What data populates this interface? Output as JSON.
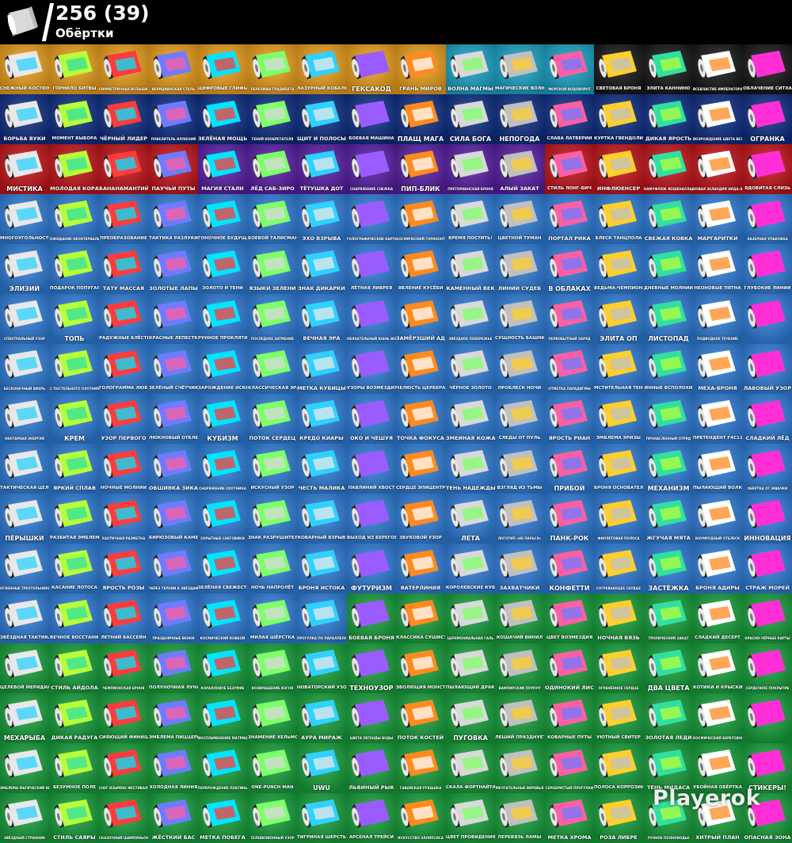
{
  "header": {
    "count": "256 (39)",
    "subtitle": "Обёртки",
    "icon": "wrap-roll-icon"
  },
  "watermark": "Playerok",
  "rarity_colors": {
    "O": "#f0a21c",
    "T": "#1aa6c9",
    "K": "#171717",
    "R": "#0e2f87",
    "E": "#c8141a",
    "P": "#5a1fa8",
    "B": "#2f7fdc",
    "G": "#17a23c"
  },
  "rows": [
    "OOOOOOOOOTTTKKKK",
    "RRRRRRRRRRRRRRRR",
    "EEEEPPPPPPPEEEEE",
    "BBBBBBBBBBBBBBBB",
    "BBBBBBBBBBBBBBBB",
    "BBBBBBBBBBBBBBBB",
    "BBBBBBBBBBBBBBBB",
    "BBBBBBBBBBBBBBBB",
    "BBBBBBBBBBBBBBBB",
    "BBBBBBBBBBBBBBBB",
    "BBBBBBBBBBBBBBBB",
    "BBBBBBBGGGGGGGGG",
    "GGGGGGGGGGGGGGGG",
    "GGGGGGGGGGGGGGGG",
    "GGGGGGGGGGGGGGGG",
    "GGGGGGGGGGGGGGGG"
  ],
  "row_classes": [
    "",
    "E",
    "",
    "",
    "",
    "",
    "",
    "",
    "",
    "",
    "",
    "",
    "",
    "",
    "",
    ""
  ],
  "palette": [
    "#e8e8e8",
    "#ff5fa2",
    "#2ed1ff",
    "#b6ff3a",
    "#ffcf2e",
    "#9b5cff",
    "#ff3b3b",
    "#31e0a0",
    "#ff8a1f",
    "#6f7bff",
    "#ffffff",
    "#d9d9d9",
    "#00e5ff",
    "#ff2fd6",
    "#c0c0c0",
    "#7dff6a"
  ],
  "items": [
    "СНЕЖНЫЙ КОСТЮМ",
    "ГОРНИЛО БИТВЫ",
    "СИММЕТРИЧНАЯ ВСПЫШКА",
    "ВЕРИДИАНСКАЯ СТАЛЬ",
    "ЦИФРОВЫЕ ГЛИФЫ",
    "ПЕРЕЛИВЫ ГРАДИЕНТА",
    "ЛАЗУРНЫЙ КОБАЛЬТ",
    "ГЕКСАКОД",
    "ГРАНЬ МИРОВ",
    "ВОЛНА МАГМЫ",
    "МАГИЧЕСКИЕ ВОЛНЫ",
    "МОРСКОЙ ВОДОВОРОТ",
    "СВЕТОВАЯ БРОНЯ",
    "ЭЛИТА КАННИНО",
    "ВСЕВЛАСТИЕ ИМПЕРАТОРА",
    "ОБЛАЧЕНИЕ СИТХА",
    "БОРЬБА ВУКИ",
    "МОМЕНТ ВЫБОРА",
    "ЧЁРНЫЙ ЛИДЕР",
    "ПОВЕЛИТЕЛЬ ИЛЛЮЗИЙ",
    "ЗЕЛЁНАЯ МОЩЬ",
    "ГЕНИЙ ИЗОБРЕТАТЕЛЯ",
    "ЩИТ И ПОЛОСЫ",
    "БОЕВАЯ МАШИНА",
    "ПЛАЩ МАГА",
    "СИЛА БОГА",
    "НЕПОГОДА",
    "СЛАВА ЛАТВЕРИИ",
    "КУРТКА ГВЕНДОЛИН",
    "ДИКАЯ ЯРОСТЬ",
    "ВОЗРОЖДЕНИЕ ЦВЕТА ВЕЗДЕ",
    "ОГРАНКА",
    "МИСТИКА",
    "МОЛОДАЯ КОРА",
    "БАНАНАМАНТИЙ",
    "ПАУЧЬИ ПУТЫ",
    "МАГИЯ СТАЛИ",
    "ЛЁД САБ-ЗИРО",
    "ТЁТУШКА ДОТ",
    "СНАРЯЖЕНИЕ СНЕЖКА",
    "ПИП-БЛИК",
    "ПРЕТОРИАНСКАЯ БРОНЯ",
    "АЛЫЙ ЗАКАТ",
    "СТИЛЬ ЛОНГ-БИЧ",
    "ИНФЛЮЕНСЕР",
    "КАМУФЛЯЖ ЯОШЕНАЛЛАДИ",
    "НОВАЯ ЗЕЛАНДИЯ НИДА-ЖАЛЬФИН",
    "ЯДОВИТАЯ СЛИЗЬ",
    "МНОГОУГОЛЬНОСТЬ",
    "ОЖИДАНИЕ НЕОНТЕРВАЛЬНИЯ",
    "ПРЕОБРАЗОВАНИЕ",
    "ТАКТИКА РАЗЛУКИ",
    "ГОНОЧНОЕ БУДУЩЕЕ",
    "БОЕВОЙ ТАЛИСМАН",
    "ЭХО ВЗРЫВА",
    "ГОЛОГРАФИЧЕСКИЕ КАРТИНКИ",
    "КОСМИЧЕСКИЙ ГОРИЗОНТ",
    "ВРЕМЯ ПОСТИТЬ!",
    "ЦВЕТНОЙ ТУМАН",
    "ПОРТАЛ РИКА",
    "БЛЕСК ТАНЦПОЛА",
    "СВЕЖАЯ КОВКА",
    "МАРГАРИТКИ",
    "ЛАЗЕРНАЯ УПАКОВКА",
    "ЭЛИЗИЙ",
    "ПОДАРОК ПОПУГАЯ",
    "ТАТУ МАССАЯ",
    "ЗОЛОТЫЕ ЛАПЫ",
    "ЗОЛОТО И ТЕНИ",
    "ЯЗЫКИ ЗЕЛЕНИ",
    "ЗНАК ДИКАРКИ",
    "ЛЁТНАЯ ЛИВРЕЯ",
    "ЯВЛЕНИЕ КУСЁБИ",
    "КАМЕННЫЙ ВЕК",
    "ЛИНИИ СУДЕБ",
    "В ОБЛАКАХ",
    "ВЕДЬМА-ЧЕМПИОНКА",
    "ДНЕВНЫЕ МОЛНИИ",
    "НЕОНОВЫЕ ПЯТНА",
    "ГЛУБОКИЕ ЛИНИИ",
    "СПЕКТРАЛЬНЫЙ УЗОР",
    "ТОПЬ",
    "РАДУЖНЫЕ БЛЁСТКИ",
    "КРАСНЫЕ ЛЕПЕСТКИ",
    "РУННОЕ ПРОКЛЯТИЕ",
    "ПОСЛЕДНЕЕ ЗАТМЕНИЕ",
    "ВЕЧНАЯ ЭРА",
    "ОБЯЗАТЕЛЬНЫЙ ЮАНЬ ВЕСТРА",
    "ЗАМЁРЗШИЙ АД",
    "ЗВЁЗДНОЕ ПОБЕРЕЖЬЕ",
    "СУЩНОСТЬ БАШНИ",
    "ПЕРВОБЫТНЫЙ ЗАРЯД",
    "ЭЛИТА ОП",
    "ЛИСТОПАД",
    "ПОДВОДНОЕ ТЕЧЕНИЕ",
    "",
    "БЕСКОНЕЧНЫЙ ВИХРЬ",
    "С ПОСТЕЛЬНОГО ОХОТНИК",
    "ГОЛОГРАММА ЛЮБВИ",
    "ЗЕЛЁНЫЙ СЧЁТЧИК",
    "ЗАРОЖДЕНИЕ ИСКРЫ",
    "КЛАССИЧЕСКАЯ ЭРА",
    "МЕТКА КУБИЦЫ",
    "УЗОРЫ ВОЗМЕЗДИЯ",
    "ЧЕЛЮСТЬ ЦЕРБЕРА",
    "ЧЁРНОЕ ЗОЛОТО",
    "ПРОБЛЕСК НОЧИ",
    "ОТМЕТКА ПАРАДИГМЫ",
    "МСТИТЕЛЬНАЯ ТЕНЬ",
    "ИННЫЕ ВСПОЛОХИ",
    "МЕХА-БРОНЯ",
    "ЛАВОВЫЙ УЗОР",
    "НЕКТАРНАЯ ЭНЕРГИЯ",
    "КРЕМ",
    "УЗОР ПЕРВОГО",
    "ЛЮКНОВЫЙ ОТБЛЕСК",
    "КУБИЗМ",
    "ПОТОК СЕРДЕЦ",
    "КРЕДО КИАРЫ",
    "ОКО И ЧЕШУЯ",
    "ТОЧКА ФОКУСА",
    "ЗМЕИНАЯ КОЖА",
    "СЛЕДЫ ОТ ПУЛЬ",
    "ЯРОСТЬ РИАН",
    "ЭМБЛЕМА ЭРИЗЫ",
    "ПРОНАСЛЕННЫЙ ОТРЯД",
    "ПРЕТЕНДЕНТ F4C11",
    "СЛАДКИЙ ЛЁД",
    "ТАКТИЧЕСКАЯ ЦЕЛЬ",
    "ЯРКИЙ СПЛАВ",
    "НОЧНЫЕ МОЛНИИ",
    "ОБШИВКА ЗИКА",
    "СНАРЯЖЕНИЕ ОХОТНИКА",
    "ИСКУСНЫЙ УЗОР",
    "ЧЕСТЬ МАЛИКА",
    "ПАВЛИНИЙ ХВОСТ",
    "СЕРДЦЕ ЭПИЦЕНТРА",
    "ТЕНЬ НАДЕЖДЫ",
    "ВЗГЛЯД ИЗ ТЬМЫ",
    "ПРИБОЙ",
    "БРОНЯ ОСНОВАТЕЛЯ",
    "МЕХАНИЗМ",
    "ПЫЛАЮЩИЙ ВОЛК",
    "ОБЁРТКА ОТ ЖВАЧКИ",
    "ПЁРЫШКИ",
    "РАЗБИТАЯ ЭМБЛЕМА",
    "ХАОТИЧНАЯ РАЗМЕТКА",
    "БИРЮЗОВЫЙ КАМЕНЬ",
    "СКРЫТНЫЕ СНЕГОВИКИ",
    "ЗНАК РАЗРУШИТЕЛЯ",
    "КОВАРНЫЙ ВЗРЫВ",
    "ВЫХОД ИЗ БЕРЕГОВ",
    "ЗВУКОВОЙ УЗОР",
    "ЛЕТА",
    "ЛОГОТИП «НЕ ПАРЬСЯ»",
    "ПАНК-РОК",
    "ФИОЛЕТОВАЯ ПОЛОСА",
    "ЖГУЧАЯ МЯТА",
    "ИЗУМРУДНЫЙ ОТБЛЕСК",
    "ИННОВАЦИЯ",
    "ОГНЕННЫЕ ТРЕУГОЛЬНИКИ",
    "КАСАНИЕ ЛОТОСА",
    "ЯРОСТЬ РОЗЫ",
    "ЧЕРЕЗ ТЕРНИИ К ЗВЁЗДАМ",
    "ЗЕЛЁНАЯ СВЕЖЕСТЬ",
    "НОЧЬ НАПРОЛЁТ",
    "БРОНЯ ИСТОКА",
    "ФУТУРИЗМ",
    "ВАТЕРЛИНИЯ",
    "КОРОЛЕВСКИЕ КУБЫ",
    "ЗАХВАТЧИКИ",
    "КОНФЕТТИ",
    "СОГРЕВАЮЩЕЕ СЕРДЦЕ",
    "ЗАСТЁЖКА",
    "БРОНЯ АДИРЫ",
    "СТРАЖ МОРЕЙ",
    "ЗВЁЗДНАЯ ТАКТИКА",
    "ВЕЧНОЕ ВОССТАНИЕ",
    "ЛЕТНИЙ БАССЕЙН",
    "ПРАЗДНИЧНЫЕ ВЕНКИ",
    "КОСМИЧЕСКИЙ КОВБОЙ",
    "МИЛАЯ ШЁРСТКА",
    "ПРОГУЛКА ПО ПАРАЛЛЕЛИ",
    "БОЕВАЯ БРОНЯ",
    "КЛАССИКА СУШИСТА",
    "ЦЕРЕМОНИАЛЬНАЯ ГАЛЬ",
    "КОШАЧИЙ ВИНИЛ",
    "ЦВЕТ ВОЗМЕЗДИЯ",
    "НОЧНАЯ ВЯЗЬ",
    "ТРОПИЧЕСКИЙ ЗАКАТ",
    "СЛАДКИЙ ДЕСЕРТ",
    "КРАСНО-ЧЁРНЫЕ КАРТЫ",
    "ЦЕЛЕВОЙ МЕРИДИАН",
    "СТИЛЬ АЙДОЛА",
    "ЧЕМПИОНСКАЯ БРОНЯ",
    "ПОЛУНОЧНАЯ ЛУНА",
    "КОРАЛЛОВОЕ БЕЗУМИЕ",
    "ВОЗВРАЩЕНИЕ ИЗГОЯ",
    "НОВАТОРСКИЙ УЗОР",
    "ТЕХНОУЗОР",
    "ЭВОЛЮЦИЯ МОНСТРА",
    "ПЫЛАЮЩИЙ ДРАКОН",
    "ВАМПИРСКИЙ ПУРПУР",
    "ОДИНОКИЙ ЛИС",
    "ОГРАНЁННОЕ СЕРДЦЕ",
    "ДВА ЦВЕТА",
    "КОТИКИ И КРЫСКИ",
    "СЕРДЕЧНОЕ ПОКРЫТИЕ",
    "МЕХАРЫБА",
    "ДИКАЯ РАДУГА",
    "СИЯЮЩИЙ ФИНИШ",
    "ЭМБЛЕМА ПИЦЦЕРИИ",
    "ВОСПЛАМЕНЕНИЕ МАТРИЦЫ",
    "ЗНАМЕНИЕ ХЕЛЬМОВ",
    "АУРА МИРАЖ",
    "ЦВЕТА ЛЕГЕНДЫ ВОДЫ",
    "ПОТОК КОСТЕЙ",
    "ПУГОВКА",
    "ЛЕШИЙ ПРАЗДНУЕТ",
    "КОВАРНЫЕ ПУТЫ",
    "УЮТНЫЙ СВИТЕР",
    "ЗОЛОТАЯ ЛЕДИ",
    "КОСМИЧЕСКИЙ БЕРЕГОВОЙ",
    "",
    "ЭМБЛЕМА МАГИЧЕСКИЙ ВИЗИТ",
    "БЕЗУМНОЕ ПОЛЕ",
    "СНЕГ ИЗЫМЕЮ ФЕСТИВАЛЯ",
    "ХОЛОДНАЯ ЛИНИЯ",
    "ПЕРЕРОЖДЕНИЕ ПЛАТИНЫ",
    "ONE-PUNCH MAN",
    "UWU",
    "ЛЬВИНЫЙ РЫК",
    "ГАВАЙСКАЯ РУБАШКА",
    "СКАЛА ФОРТНАЙТА",
    "МЕЧТАТЕЛЬНЫЕ ВИРЕВЬЯ",
    "СЕРЕБРИСТЫЙ ПРОГУЛКИ",
    "ПОЛОСА КОРРОЗИИ",
    "ТЕНЬ МИДАСА",
    "УБОЙНАЯ ОБЁРТКА",
    "СТИКЕРЫ!",
    "ЗВЁЗДНЫЙ СТРАННИК",
    "СТИЛЬ САЯРЫ",
    "СКАЗОЧНЫЙ ШАМПИНЬОН",
    "ЖЁСТКИЙ БАС",
    "МЕТКА ПОБЕГА",
    "ТЕЛЕВИЗИОННЫЙ УЗОР",
    "ТИГРИНАЯ ШЕРСТЬ",
    "АРСЕНАЛ ТРЕЙСИ",
    "ИСКУССТВО ЭЛЛИПСИСА",
    "ЦВЕТ ПРОВИДЕНИЯ",
    "ПЕРЕВЯЗЬ ЛАМЫ",
    "МЕТКА ХРОМА",
    "РОЗА ЛИБРЕ",
    "ЛУННОЕ ПОЛНОВОДЬЕ",
    "ХИТРЫЙ ПЛАН",
    "ОПАСНАЯ ЗОНА"
  ]
}
